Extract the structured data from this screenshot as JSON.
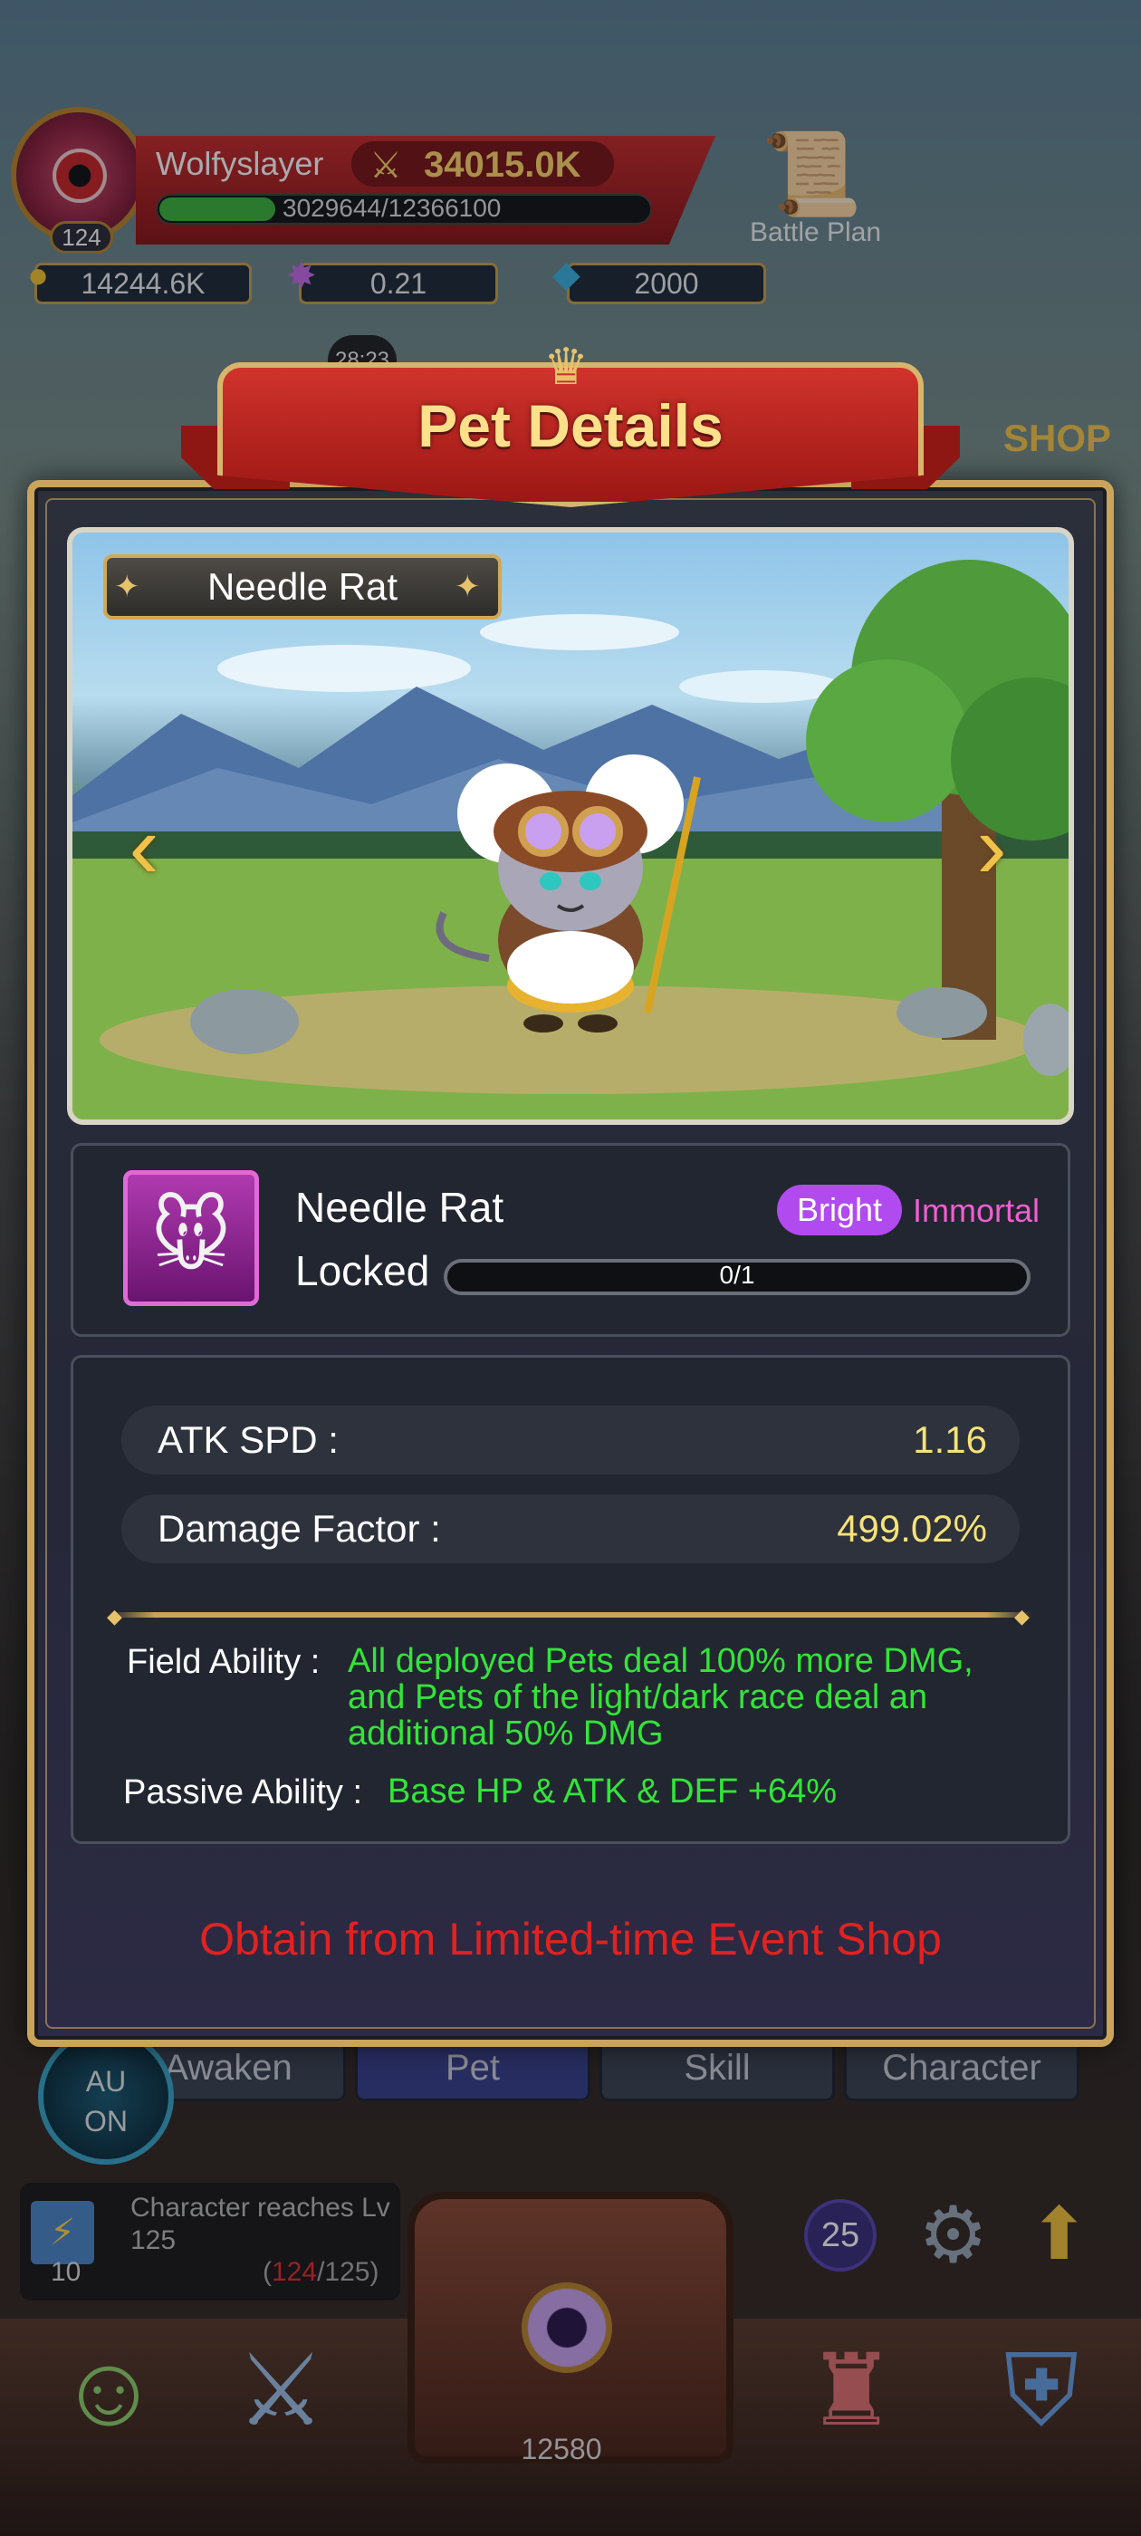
{
  "hud": {
    "player_name": "Wolfyslayer",
    "player_level": "124",
    "power": "34015.0K",
    "xp": "3029644/12366100",
    "xp_fraction": 0.245,
    "gold": "14244.6K",
    "gems_rate": "0.21",
    "diamonds": "2000",
    "battle_plan_label": "Battle Plan",
    "timer": "28:23",
    "shop_label": "SHOP"
  },
  "bottom": {
    "tabs": [
      "Awaken",
      "Pet",
      "Skill",
      "Character"
    ],
    "auto_label": "AU\nON",
    "quest_text": "Character reaches Lv 125",
    "quest_count": "10",
    "quest_progress_current": "124",
    "quest_progress_total": "/125)",
    "quest_progress_open": "(",
    "round_badge": "25",
    "chest_counter": "12580"
  },
  "modal": {
    "title": "Pet Details",
    "nameplate": "Needle Rat",
    "pet": {
      "name": "Needle Rat",
      "status": "Locked",
      "race": "Bright",
      "rarity": "Immortal",
      "shards": "0/1"
    },
    "stats": [
      {
        "label": "ATK SPD :",
        "value": "1.16"
      },
      {
        "label": "Damage Factor :",
        "value": "499.02%"
      }
    ],
    "abilities": {
      "field_label": "Field Ability :",
      "field_text_1": "All deployed Pets deal 100% more DMG,",
      "field_text_2": "and Pets of the light/dark race deal an",
      "field_text_3": "additional 50% DMG",
      "passive_label": "Passive Ability :",
      "passive_text": "Base HP & ATK & DEF +64%"
    },
    "source": "Obtain from Limited-time Event Shop"
  },
  "icons": {
    "arrow_left": "‹",
    "arrow_right": "›",
    "star": "✦"
  },
  "colors": {
    "title_gold": "#ffe08a",
    "ability_green": "#33e43a",
    "source_red": "#e02222",
    "race_purple": "#b14bf0",
    "rarity_pink": "#f05fd0",
    "stat_yellow": "#f6e27a"
  }
}
